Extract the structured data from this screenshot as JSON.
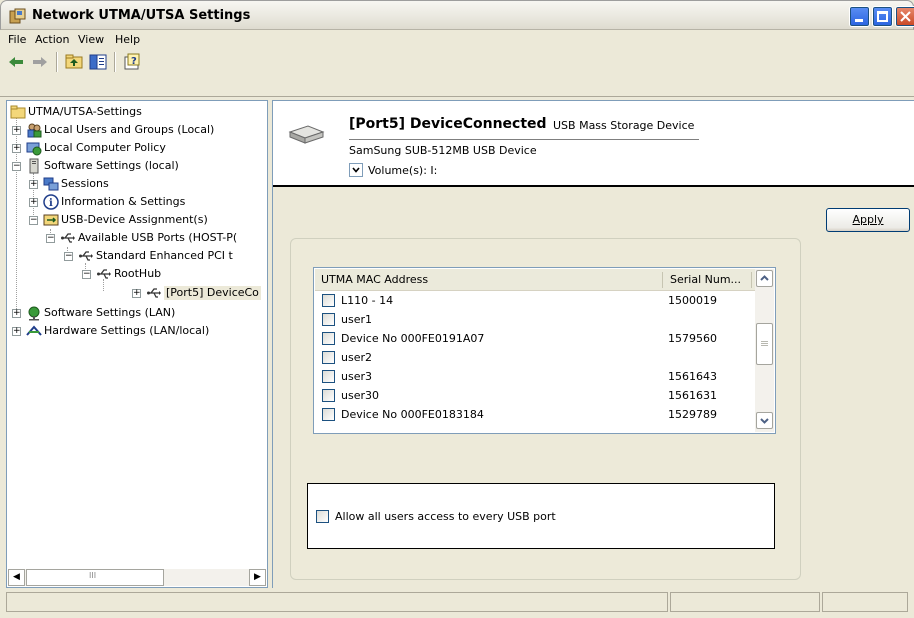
{
  "window": {
    "title": "Network UTMA/UTSA Settings"
  },
  "menu": {
    "file": "File",
    "action": "Action",
    "view": "View",
    "help": "Help"
  },
  "tree": {
    "items": [
      {
        "label": "UTMA/UTSA-Settings"
      },
      {
        "label": "Local Users and Groups (Local)"
      },
      {
        "label": "Local Computer Policy"
      },
      {
        "label": "Software Settings (local)"
      },
      {
        "label": "Sessions"
      },
      {
        "label": "Information & Settings"
      },
      {
        "label": "USB-Device Assignment(s)"
      },
      {
        "label": "Available USB Ports (HOST-P("
      },
      {
        "label": "Standard Enhanced PCI t"
      },
      {
        "label": "RootHub"
      },
      {
        "label": "[Port5] DeviceCo"
      },
      {
        "label": "Software Settings (LAN)"
      },
      {
        "label": "Hardware Settings (LAN/local)"
      }
    ]
  },
  "device": {
    "title": "[Port5] DeviceConnected",
    "type": "USB Mass Storage Device",
    "name": "SamSung  SUB-512MB USB Device",
    "volumes_label": "Volume(s):  I:"
  },
  "apply_label": "Apply",
  "list": {
    "columns": [
      "UTMA MAC Address",
      "Serial Num..."
    ],
    "rows": [
      {
        "name": "L110 - 14",
        "serial": "1500019"
      },
      {
        "name": "user1",
        "serial": ""
      },
      {
        "name": "Device No  000FE0191A07",
        "serial": "1579560"
      },
      {
        "name": "user2",
        "serial": ""
      },
      {
        "name": "user3",
        "serial": "1561643"
      },
      {
        "name": "user30",
        "serial": "1561631"
      },
      {
        "name": "Device No  000FE0183184",
        "serial": "1529789"
      }
    ]
  },
  "allow_all_label": "Allow all users access to every USB port",
  "hscroll_grip": "III"
}
